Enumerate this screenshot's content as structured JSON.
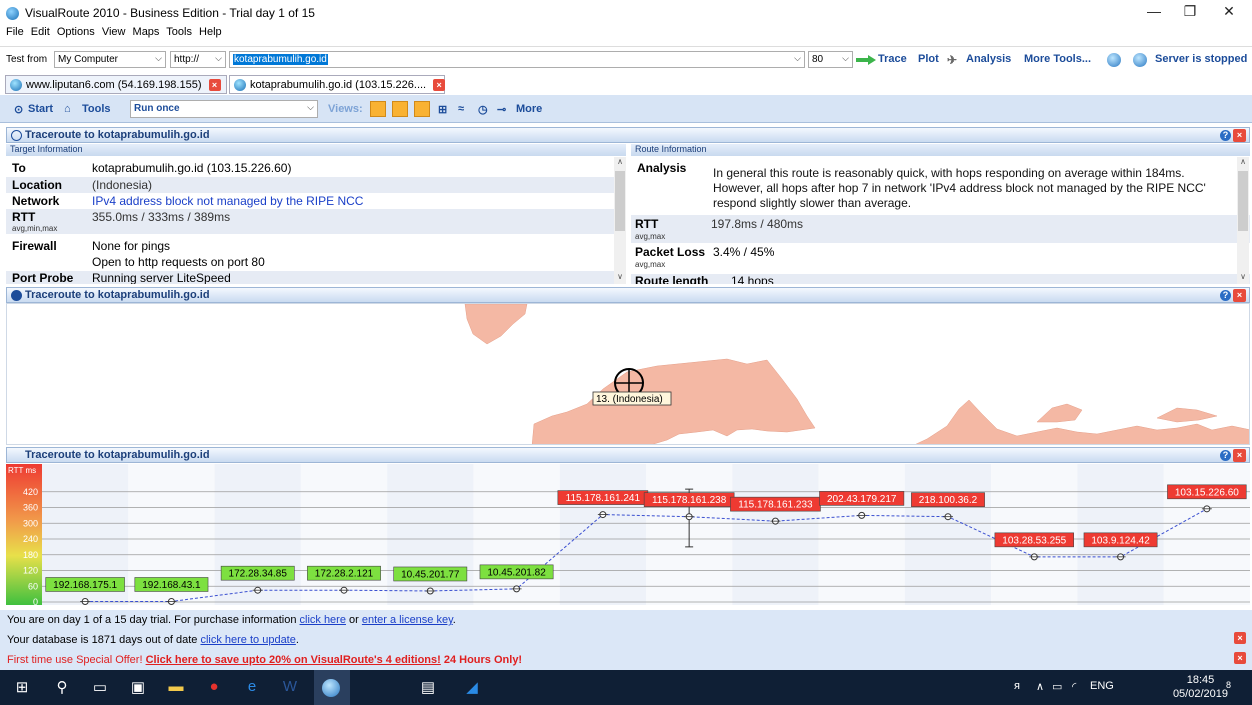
{
  "window": {
    "title": "VisualRoute 2010 - Business Edition - Trial day 1 of 15",
    "minimize": "—",
    "maximize": "❐",
    "close": "✕"
  },
  "menu": [
    "File",
    "Edit",
    "Options",
    "View",
    "Maps",
    "Tools",
    "Help"
  ],
  "toolbar": {
    "test_from_label": "Test from",
    "test_from_value": "My Computer",
    "protocol": "http://",
    "url_value": "kotaprabumulih.go.id",
    "port": "80",
    "trace": "Trace",
    "plot": "Plot",
    "analysis": "Analysis",
    "more_tools": "More Tools...",
    "server_status": "Server is stopped"
  },
  "tabs": [
    {
      "label": "www.liputan6.com (54.169.198.155)"
    },
    {
      "label": "kotaprabumulih.go.id (103.15.226...."
    }
  ],
  "toolbar2": {
    "start": "Start",
    "tools": "Tools",
    "run_mode": "Run once",
    "views_label": "Views:",
    "more": "More"
  },
  "panels": {
    "summary_title": "Traceroute to kotaprabumulih.go.id",
    "map_title": "Traceroute to kotaprabumulih.go.id",
    "graph_title": "Traceroute to kotaprabumulih.go.id",
    "target_header": "Target Information",
    "route_header": "Route Information"
  },
  "target_info": [
    {
      "key": "To",
      "sub": "",
      "value": "kotaprabumulih.go.id (103.15.226.60)"
    },
    {
      "key": "Location",
      "sub": "",
      "value": "(Indonesia)"
    },
    {
      "key": "Network",
      "sub": "",
      "value": "IPv4 address block not managed by the RIPE NCC"
    },
    {
      "key": "RTT",
      "sub": "avg,min,max",
      "value": "355.0ms / 333ms / 389ms"
    },
    {
      "key": "Firewall",
      "sub": "",
      "value": "None for pings"
    },
    {
      "key": "",
      "sub": "",
      "value": "Open to http requests on port 80"
    },
    {
      "key": "Port Probe",
      "sub": "",
      "value": "Running server LiteSpeed"
    }
  ],
  "route_info": {
    "analysis_key": "Analysis",
    "analysis_lines": [
      "In general this route is reasonably quick, with hops responding on average within 184ms.",
      "However, all hops after hop 7 in network 'IPv4 address block not managed by the RIPE NCC'",
      "respond slightly slower than average."
    ],
    "rtt_key": "RTT",
    "rtt_sub": "avg,max",
    "rtt_value": "197.8ms / 480ms",
    "loss_key": "Packet Loss",
    "loss_sub": "avg,max",
    "loss_value": "3.4% / 45%",
    "length_key": "Route length",
    "length_value": "14 hops"
  },
  "map": {
    "marker_label": "13. (Indonesia)",
    "land_color": "#f4b8a4"
  },
  "chart_data": {
    "type": "line",
    "ylabel": "RTT ms",
    "yticks": [
      0,
      60,
      120,
      180,
      240,
      300,
      360,
      420
    ],
    "ylim": [
      0,
      480
    ],
    "hops": [
      {
        "ip": "192.168.175.1",
        "rtt": 2,
        "status": "green"
      },
      {
        "ip": "192.168.43.1",
        "rtt": 2,
        "status": "green"
      },
      {
        "ip": "172.28.34.85",
        "rtt": 45,
        "status": "green"
      },
      {
        "ip": "172.28.2.121",
        "rtt": 45,
        "status": "green"
      },
      {
        "ip": "10.45.201.77",
        "rtt": 42,
        "status": "green"
      },
      {
        "ip": "10.45.201.82",
        "rtt": 50,
        "status": "green"
      },
      {
        "ip": "115.178.161.241",
        "rtt": 333,
        "status": "red"
      },
      {
        "ip": "115.178.161.238",
        "rtt": 325,
        "status": "red",
        "err_low": 210,
        "err_high": 430
      },
      {
        "ip": "115.178.161.233",
        "rtt": 308,
        "status": "red"
      },
      {
        "ip": "202.43.179.217",
        "rtt": 330,
        "status": "red"
      },
      {
        "ip": "218.100.36.2",
        "rtt": 325,
        "status": "red"
      },
      {
        "ip": "103.28.53.255",
        "rtt": 172,
        "status": "red"
      },
      {
        "ip": "103.9.124.42",
        "rtt": 172,
        "status": "red"
      },
      {
        "ip": "103.15.226.60",
        "rtt": 355,
        "status": "red"
      }
    ],
    "colors": {
      "green": "#7de040",
      "red": "#ee3a32",
      "line": "#3a4fd0"
    }
  },
  "status": {
    "line1_text": "You are on day 1 of a 15 day trial. For purchase information ",
    "line1_link1": "click here",
    "line1_mid": " or ",
    "line1_link2": "enter a license key",
    "line1_end": ".",
    "line2_text": "Your database is 1871 days out of date ",
    "line2_link": "click here to update",
    "line2_end": ".",
    "line3_text": "First time use Special Offer! ",
    "line3_link": "Click here to save upto 20% on VisualRoute's 4 editions!",
    "line3_end": " 24 Hours Only!"
  },
  "taskbar": {
    "lang": "ENG",
    "time": "18:45",
    "date": "05/02/2019",
    "notifications": "8"
  }
}
